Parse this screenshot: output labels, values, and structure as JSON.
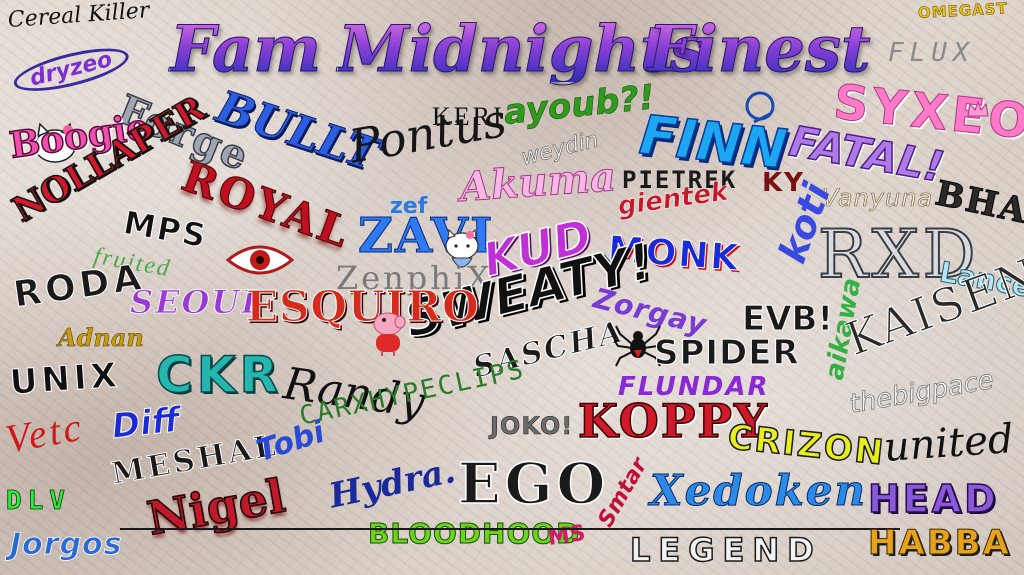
{
  "title": {
    "word1": "Fam",
    "word2": "Midnights",
    "word3": "Finest"
  },
  "names": {
    "cereal_killer": "Cereal Killer",
    "omegast": "OMEGAST",
    "flux": "FLUX",
    "dryzeo": "dryzeo",
    "forge": "Forge",
    "bullt": "BULLT",
    "syxeo": "SYXEO",
    "boogie": "Boogie",
    "keri": "KERI",
    "ayoub": "ayoub?!",
    "finn": "FINN",
    "fatal": "FATAL!",
    "nollaper": "NOLLAPER",
    "royal": "ROYAL",
    "pontus": "Pontus",
    "weydin": "weydin",
    "akuma": "Akuma",
    "pietrek": "PIETREK",
    "ky": "KY",
    "gientek": "gientek",
    "vanyuna": "Vanyuna",
    "bhas": "BHAS",
    "mps": "MPS",
    "zef": "zef",
    "zavi": "ZAVI",
    "kud": "KUD",
    "monk": "MONK",
    "koti": "koti",
    "rxd": "RXD",
    "lancer": "Lancer",
    "fruited": "fruited",
    "roda": "RODA",
    "zenphix": "ZenphiX",
    "sweaty": "SWEATY!",
    "zorgay": "Zorgay",
    "evb": "EVB!",
    "seoul": "SEOUL",
    "esquiro": "ESQUIRO",
    "sascha": "SASCHA",
    "spider": "SPIDER",
    "aikawa": "aikawa",
    "kaisen": "KAISEN",
    "adnan": "Adnan",
    "unix": "UNIX",
    "ckr": "CKR",
    "randy": "Randy",
    "hypeclips": "CARXHYPECLIPS",
    "flundar": "FLUNDAR",
    "thebigpace": "thebigpace",
    "vetc": "Vetc",
    "diff": "Diff",
    "joko": "JOKO!",
    "koppy": "KOPPY",
    "crizon": "CRIZON",
    "united": "united",
    "meshal": "MESHAL",
    "tobi": "Tobi",
    "ego": "EGO",
    "xedoken": "Xedoken",
    "head": "HEAD",
    "dlv": "DLV",
    "nigel": "Nigel",
    "hydra": "Hydra.",
    "bloodhood": "BLOODHOOD",
    "ms": "MS",
    "smtar": "Smtar",
    "legend": "LEGEND",
    "habba": "HABBA",
    "jorgos": "Jorgos"
  },
  "icons": {
    "hello_kitty_1": "hello-kitty-icon",
    "hello_kitty_2": "hello-kitty-icon",
    "eye": "eye-icon",
    "peppa": "peppa-pig-icon",
    "spider": "spider-icon",
    "crown": "crown-icon"
  },
  "colors": {
    "title_top": "#d870e0",
    "title_bottom": "#2b2fb8",
    "paper": "#d9cfc6"
  }
}
